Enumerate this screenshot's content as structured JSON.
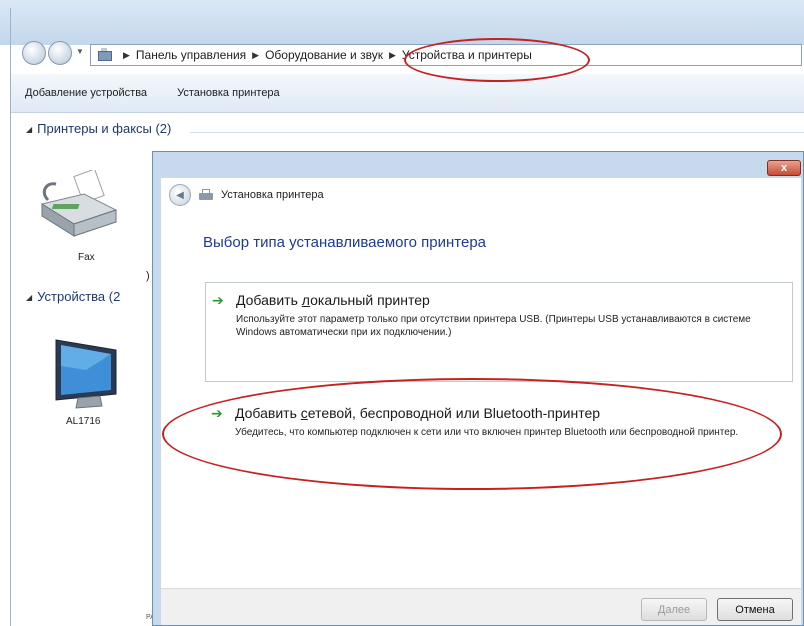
{
  "explorer": {
    "breadcrumb": [
      "Панель управления",
      "Оборудование и звук",
      "Устройства и принтеры"
    ],
    "toolbar": [
      "Добавление устройства",
      "Установка принтера"
    ],
    "groups": {
      "printers": "Принтеры и факсы (2)",
      "devices": "Устройства (2"
    },
    "items": {
      "fax": "Fax",
      "monitor": "AL1716"
    },
    "paren_fragment": ")",
    "bottom_fragment": "PA"
  },
  "dialog": {
    "title": "Установка принтера",
    "close_label": "x",
    "heading": "Выбор типа устанавливаемого принтера",
    "options": [
      {
        "title": "Добавить локальный принтер",
        "underline_char": "л",
        "description": "Используйте этот параметр только при отсутствии принтера USB. (Принтеры USB устанавливаются в системе Windows автоматически при их подключении.)"
      },
      {
        "title": "Добавить сетевой, беспроводной или Bluetooth-принтер",
        "underline_char": "с",
        "description": "Убедитесь, что компьютер подключен к сети или что включен принтер Bluetooth или беспроводной принтер."
      }
    ],
    "buttons": {
      "next": "Далее",
      "cancel": "Отмена"
    }
  },
  "annotation_color": "#c62020",
  "icons": [
    "back-arrow-icon",
    "forward-arrow-icon",
    "control-panel-icon",
    "fax-icon",
    "monitor-icon",
    "printer-icon",
    "green-arrow-icon"
  ]
}
